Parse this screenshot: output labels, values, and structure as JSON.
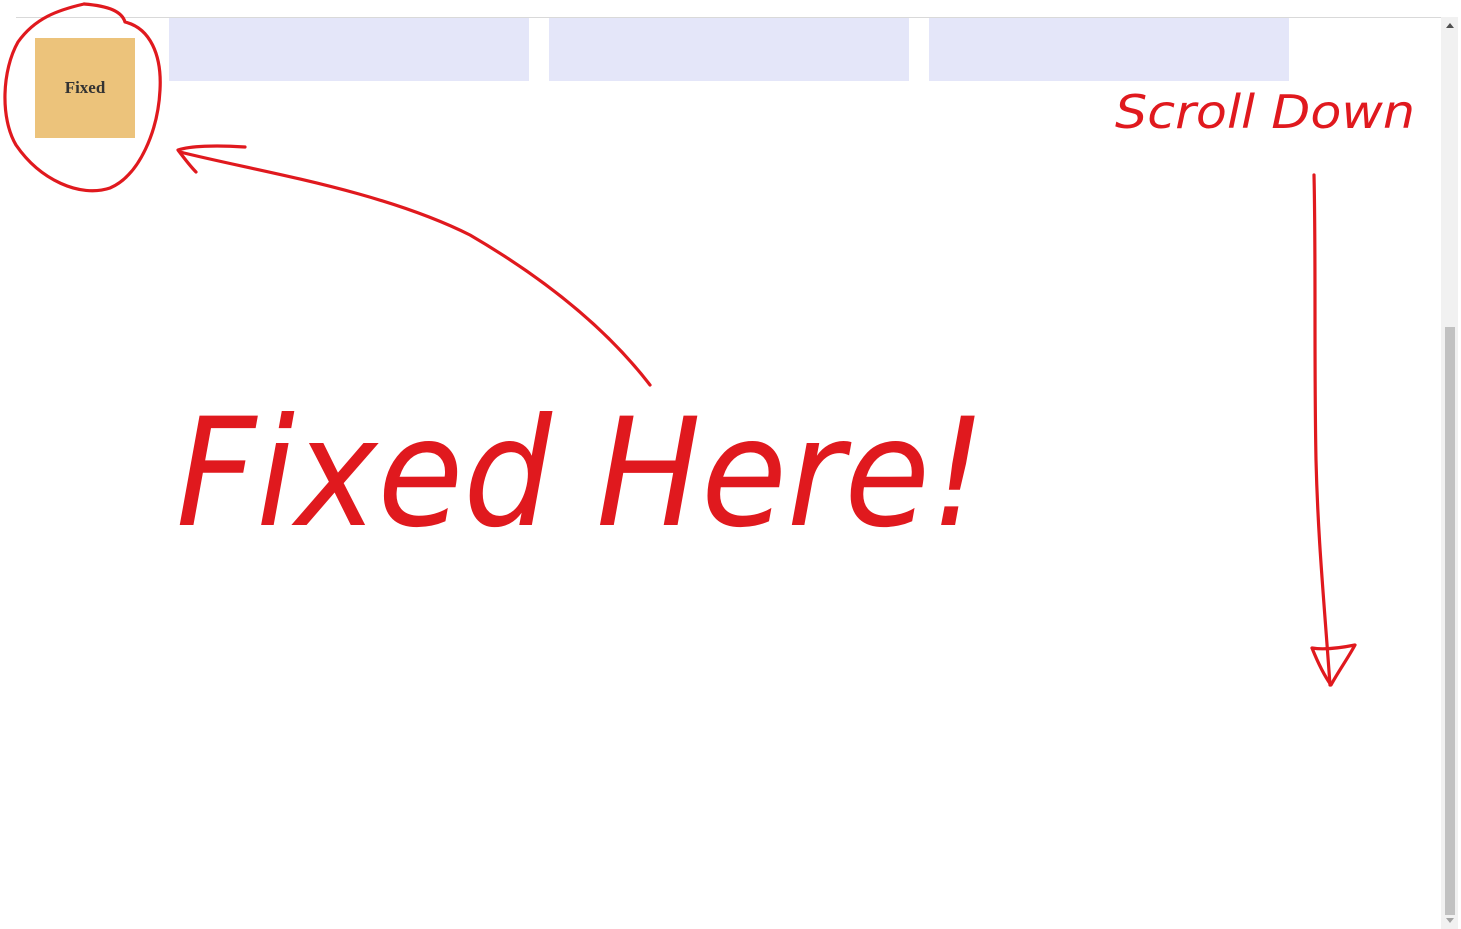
{
  "fixed_element": {
    "label": "Fixed"
  },
  "annotations": {
    "scroll_hint": "Scroll Down",
    "fixed_hint": "Fixed Here!",
    "ink_color": "#e0191e"
  },
  "colors": {
    "content_box": "#e4e6f9",
    "fixed_box": "#ecc37b",
    "scrollbar_thumb": "#c1c1c1"
  }
}
